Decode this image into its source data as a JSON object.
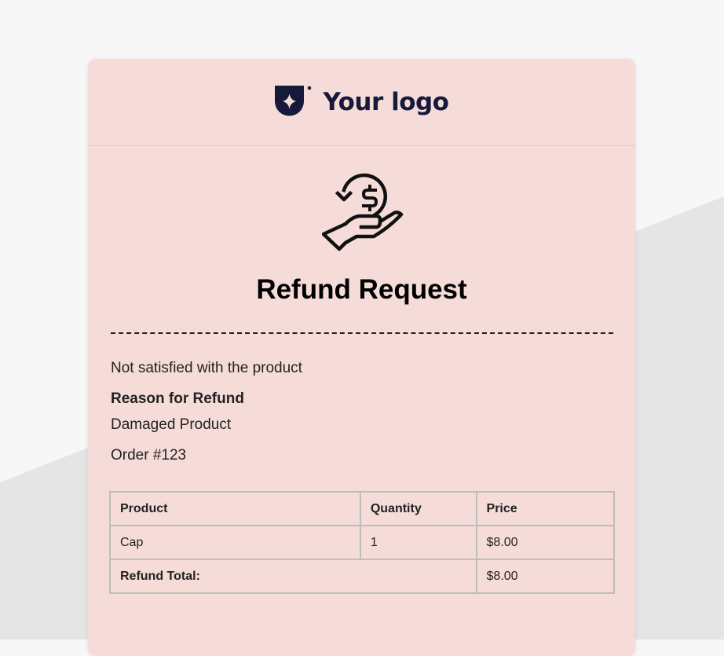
{
  "brand": {
    "logo_text": "Your logo",
    "logo_color": "#16193a"
  },
  "card_background": "#f5dcd9",
  "hero_icon": "refund-hand-dollar-icon",
  "title": "Refund Request",
  "message": "Not satisfied with the product",
  "reason": {
    "label": "Reason for Refund",
    "value": "Damaged Product"
  },
  "order_number": "Order #123",
  "table": {
    "headers": [
      "Product",
      "Quantity",
      "Price"
    ],
    "rows": [
      {
        "product": "Cap",
        "quantity": "1",
        "price": "$8.00"
      }
    ],
    "total_label": "Refund Total:",
    "total_value": "$8.00"
  }
}
